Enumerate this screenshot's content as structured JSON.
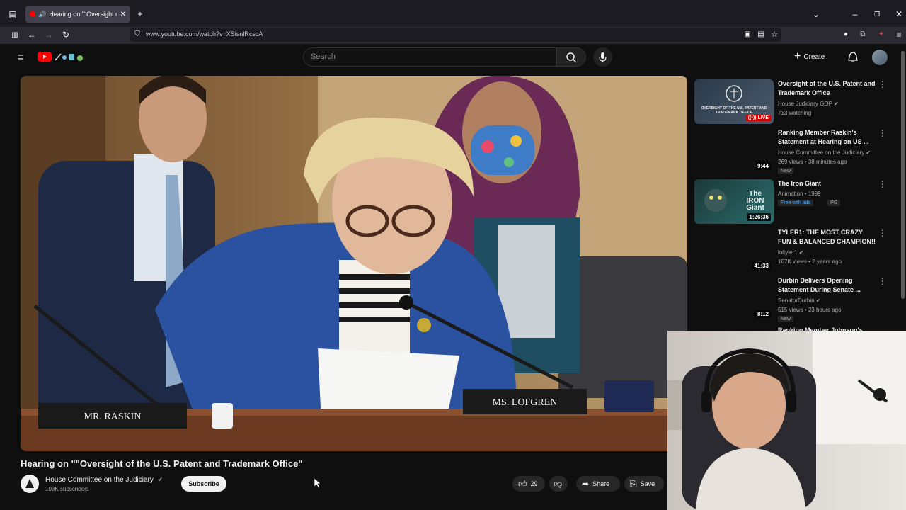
{
  "browser": {
    "tab_title": "Hearing on \"\"Oversight of t",
    "url": "www.youtube.com/watch?v=XSisnlRcscA"
  },
  "header": {
    "search_placeholder": "Search",
    "create_label": "Create"
  },
  "video": {
    "nameplate_left": "MR. RASKIN",
    "nameplate_right": "MS. LOFGREN"
  },
  "watch": {
    "title": "Hearing on \"\"Oversight of the U.S. Patent and Trademark Office\"",
    "channel": "House Committee on the Judiciary",
    "subscribers": "103K subscribers",
    "subscribe_label": "Subscribe",
    "likes": "29",
    "share_label": "Share",
    "save_label": "Save"
  },
  "sidebar": {
    "items": [
      {
        "title": "Oversight of the U.S. Patent and Trademark Office",
        "channel": "House Judiciary GOP",
        "meta": "713 watching",
        "badge": "LIVE",
        "thumb_caption": "OVERSIGHT OF THE U.S. PATENT AND TRADEMARK OFFICE"
      },
      {
        "title": "Ranking Member Raskin's Statement at Hearing on US ...",
        "channel": "House Committee on the Judiciary",
        "meta": "269 views • 38 minutes ago",
        "badge": "New",
        "duration": "9:44"
      },
      {
        "title": "The Iron Giant",
        "channel": "Animation • 1999",
        "meta": "Free with ads",
        "badge": "PG",
        "duration": "1:26:36",
        "thumb_caption": "The IRON Giant"
      },
      {
        "title": "TYLER1: THE MOST CRAZY FUN & BALANCED CHAMPION!!",
        "channel": "loltyler1",
        "meta": "167K views • 2 years ago",
        "duration": "41:33"
      },
      {
        "title": "Durbin Delivers Opening Statement During Senate ...",
        "channel": "SenatorDurbin",
        "meta": "515 views • 23 hours ago",
        "badge": "New",
        "duration": "8:12"
      },
      {
        "title": "Ranking Member Johnson's"
      }
    ]
  },
  "colors": {
    "background": "#0f0f0f",
    "accent_red": "#ff0000",
    "live_red": "#cc0000",
    "free_green": "#3ea6ff"
  }
}
